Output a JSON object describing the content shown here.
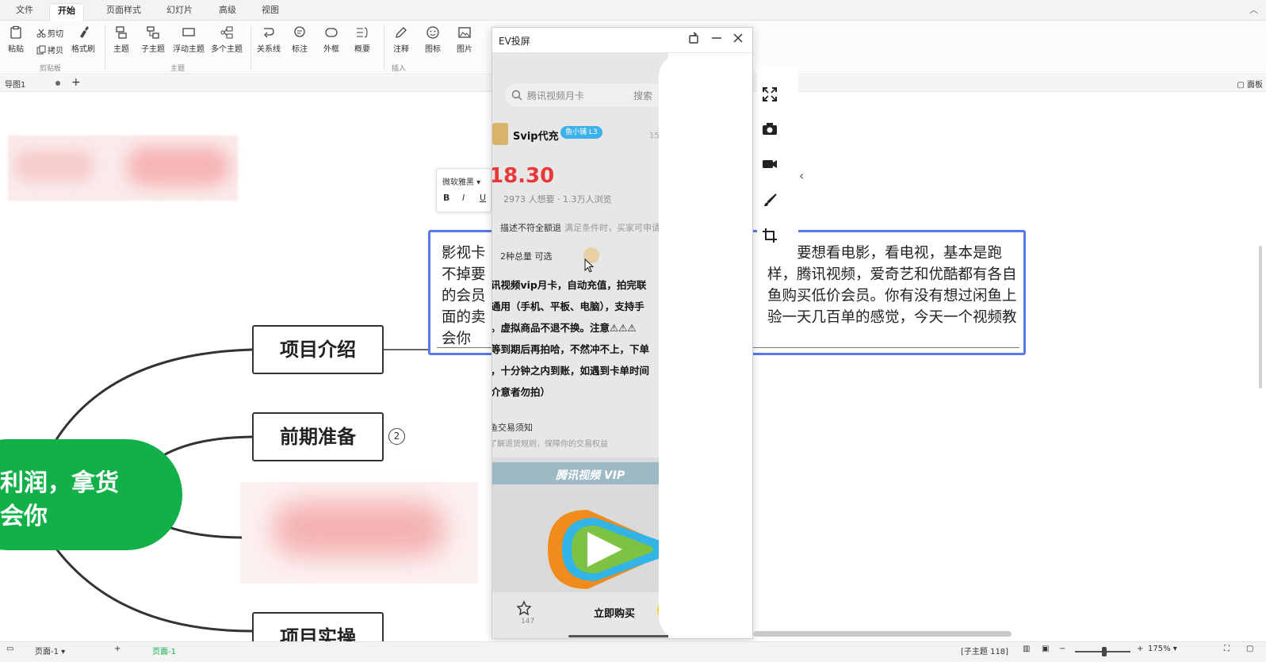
{
  "ribbon": {
    "tabs": [
      "文件",
      "开始",
      "页面样式",
      "幻灯片",
      "高级",
      "视图"
    ],
    "active_tab": "开始",
    "clipboard": {
      "paste": "粘贴",
      "cut": "剪切",
      "copy": "拷贝",
      "format_painter": "格式刷",
      "group": "剪贴板"
    },
    "topic": {
      "topic": "主题",
      "subtopic": "子主题",
      "floating_topic": "浮动主题",
      "multi_topic": "多个主题",
      "group": "主题"
    },
    "insert": {
      "relationship": "关系线",
      "callout": "标注",
      "boundary": "外框",
      "summary": "概要",
      "note": "注释",
      "icon": "图标",
      "image": "图片",
      "group": "插入"
    }
  },
  "doc_tabs": {
    "tab": "导图1",
    "panel": "面板"
  },
  "mindmap": {
    "central": {
      "line1": "利润，拿货",
      "line2": "会你"
    },
    "topics": [
      "项目介绍",
      "前期准备",
      "项目实操"
    ],
    "badge": "2",
    "text_editor": {
      "font": "微软雅黑",
      "bold": "B",
      "italic": "I",
      "underline": "U",
      "lines_left": [
        "影视卡",
        "不掉要",
        "的会员",
        "面的卖",
        "会你"
      ],
      "lines_right": [
        "要想看电影，看电视，基本是跑",
        "样，腾讯视频，爱奇艺和优酷都有各自",
        "鱼购买低价会员。你有没有想过闲鱼上",
        "验一天几百单的感觉，今天一个视频教",
        ""
      ]
    }
  },
  "ev_window": {
    "title": "EV投屏",
    "phone": {
      "search_placeholder": "腾讯视频月卡",
      "search_button": "搜索",
      "seller_name": "Svip代充",
      "seller_badge": "鱼小铺 L3",
      "time": "15分",
      "price": "18.30",
      "stats": "2973 人想要 · 1.3万人浏览",
      "refund_title": "描述不符全额退",
      "refund_sub": "满足条件时，买家可申请",
      "options": "2种总量 可选",
      "body_lines": [
        "讯视频vip月卡，自动充值，拍完联",
        "通用（手机、平板、电脑），支持手",
        "。虚拟商品不退不换。注意⚠⚠⚠",
        "等到期后再拍哈，不然冲不上，下单",
        "，十分钟之内到账，如遇到卡单时间",
        "介意者勿拍）"
      ],
      "notice_title": "鱼交易须知",
      "notice_sub": "了解退货规则，保障你的交易权益",
      "banner_label": "腾讯视频 VIP",
      "fav_count": "147",
      "buy_label": "立即购买"
    }
  },
  "status": {
    "page": "页面-1",
    "page_tab": "页面-1",
    "subtopic_count": "[子主题 118]",
    "zoom": "175%"
  },
  "colors": {
    "central": "#11b048",
    "selection": "#5a78e6",
    "price": "#e8383a"
  }
}
